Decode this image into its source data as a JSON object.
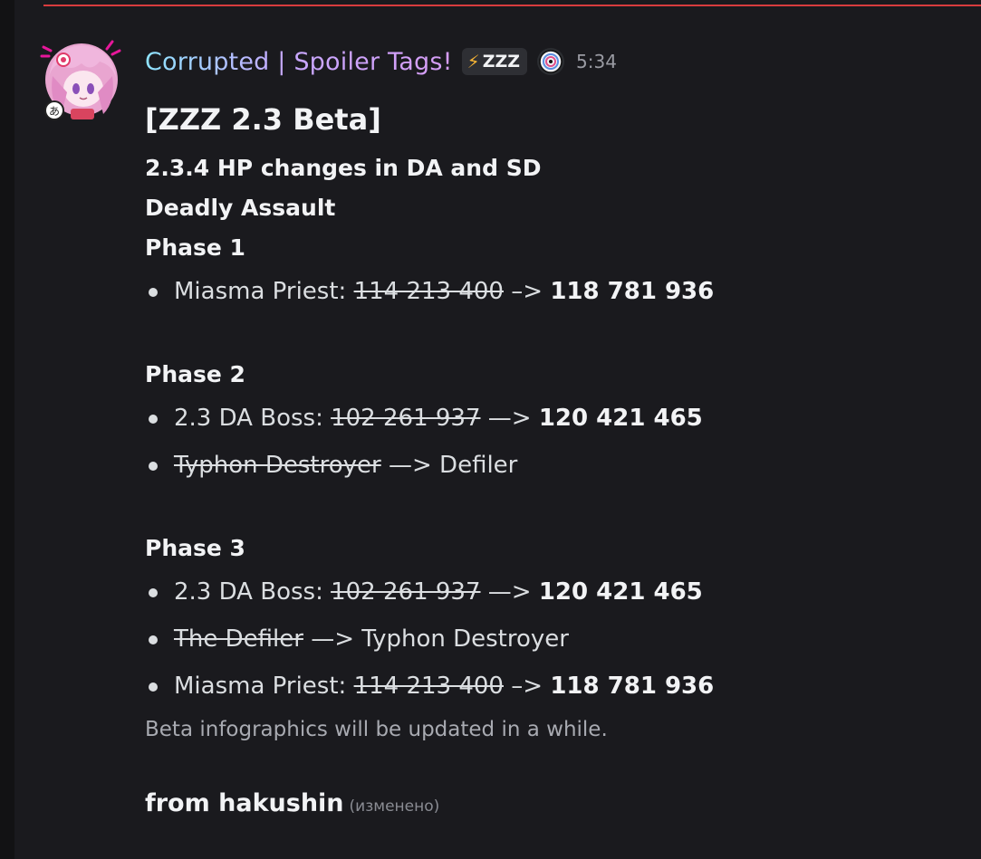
{
  "colors": {
    "background": "#1a1a1e",
    "divider": "#d83c3e",
    "bolt": "#f9b534"
  },
  "message": {
    "author": "Corrupted | Spoiler Tags!",
    "tag_icon": "lightning-bolt-icon",
    "tag_label": "ZZZ",
    "role_icon": "server-badge-icon",
    "timestamp": "5:34",
    "title": "[ZZZ 2.3 Beta]",
    "subtitle": "2.3.4 HP changes in DA and SD",
    "section": "Deadly Assault",
    "phases": [
      {
        "label": "Phase 1",
        "items": [
          {
            "prefix": "Miasma Priest: ",
            "old": "114 213 400",
            "arrow": " –> ",
            "new": "118 781 936"
          }
        ]
      },
      {
        "label": "Phase 2",
        "items": [
          {
            "prefix": "2.3 DA Boss: ",
            "old": "102 261 937",
            "arrow": " —> ",
            "new": "120 421 465"
          },
          {
            "prefix": "",
            "old": "Typhon Destroyer",
            "arrow": " —> ",
            "plain": "Defiler"
          }
        ]
      },
      {
        "label": "Phase 3",
        "items": [
          {
            "prefix": "2.3 DA Boss: ",
            "old": "102 261 937",
            "arrow": " —> ",
            "new": "120 421 465"
          },
          {
            "prefix": "",
            "old": "The Defiler",
            "arrow": " —> ",
            "plain": "Typhon Destroyer"
          },
          {
            "prefix": "Miasma Priest: ",
            "old": "114 213 400",
            "arrow": " –> ",
            "new": "118 781 936"
          }
        ]
      }
    ],
    "note": "Beta infographics will be updated in a while.",
    "from": "from hakushin",
    "edited": "(изменено)"
  }
}
